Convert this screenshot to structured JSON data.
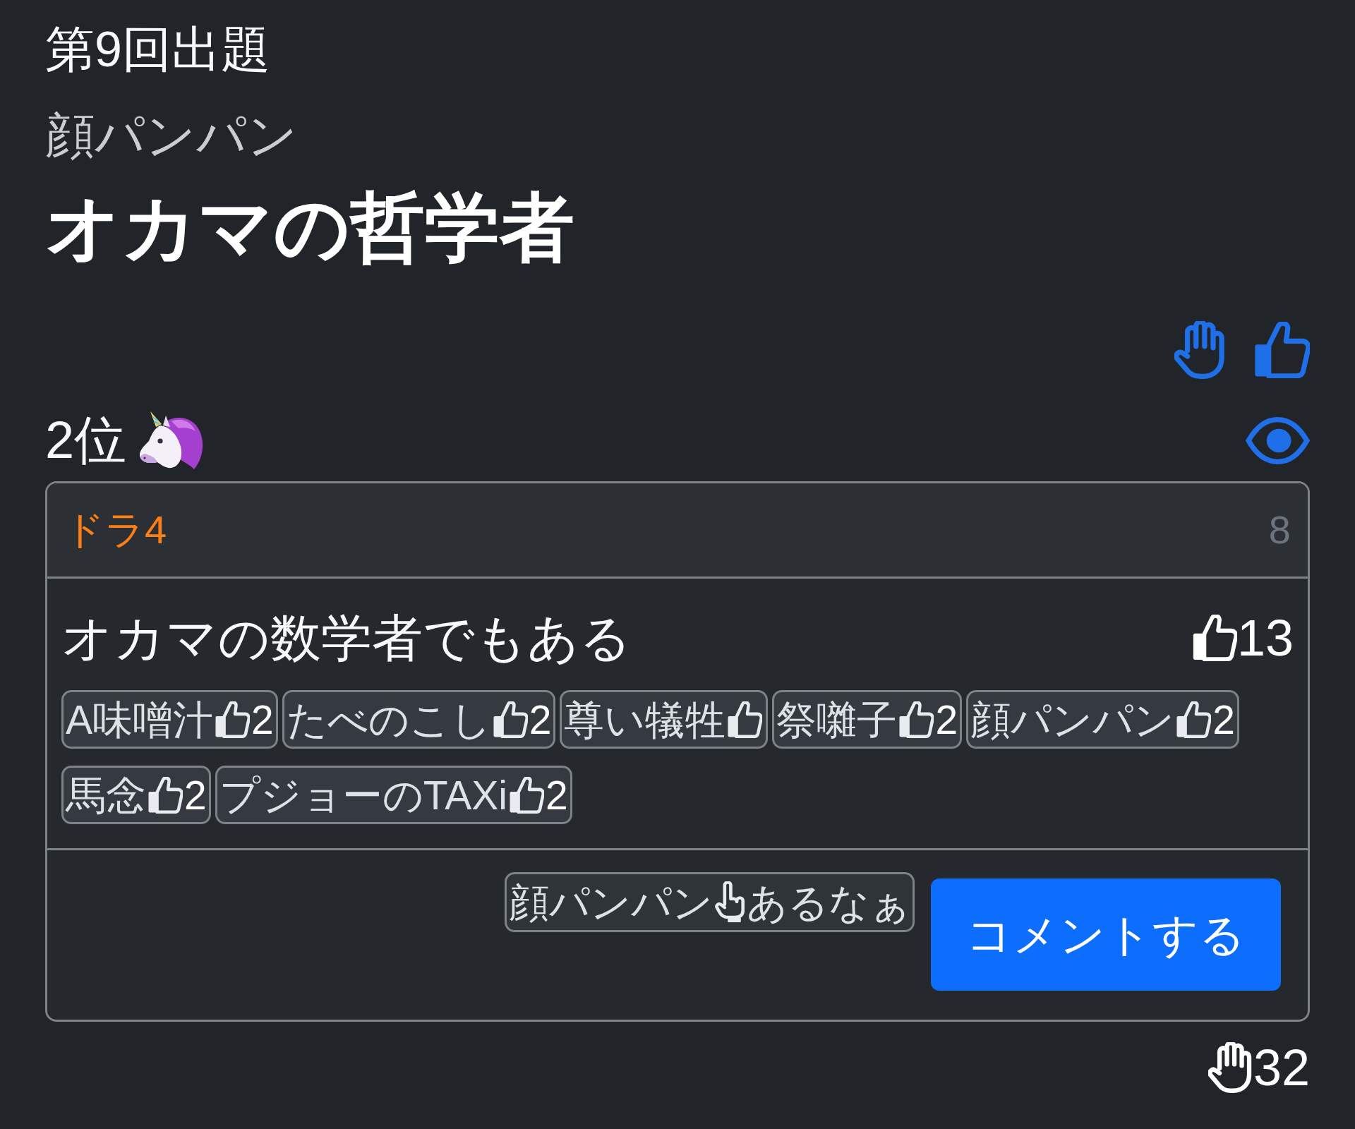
{
  "round_label": "第9回出題",
  "author": "顔パンパン",
  "title": "オカマの哲学者",
  "rank": "2位",
  "answer": {
    "label": "ドラ4",
    "number": "8",
    "text": "オカマの数学者でもある",
    "likes": "13",
    "reactions": [
      {
        "name": "A味噌汁",
        "count": "2"
      },
      {
        "name": "たべのこし",
        "count": "2"
      },
      {
        "name": "尊い犠牲"
      },
      {
        "name": "祭囃子",
        "count": "2"
      },
      {
        "name": "顔パンパン",
        "count": "2"
      },
      {
        "name": "馬念",
        "count": "2"
      },
      {
        "name": "プジョーのTAXi",
        "count": "2"
      }
    ],
    "comment": {
      "user": "顔パンパン",
      "text": "あるなぁ"
    },
    "button_label": "コメントする"
  },
  "raise_count": "32"
}
